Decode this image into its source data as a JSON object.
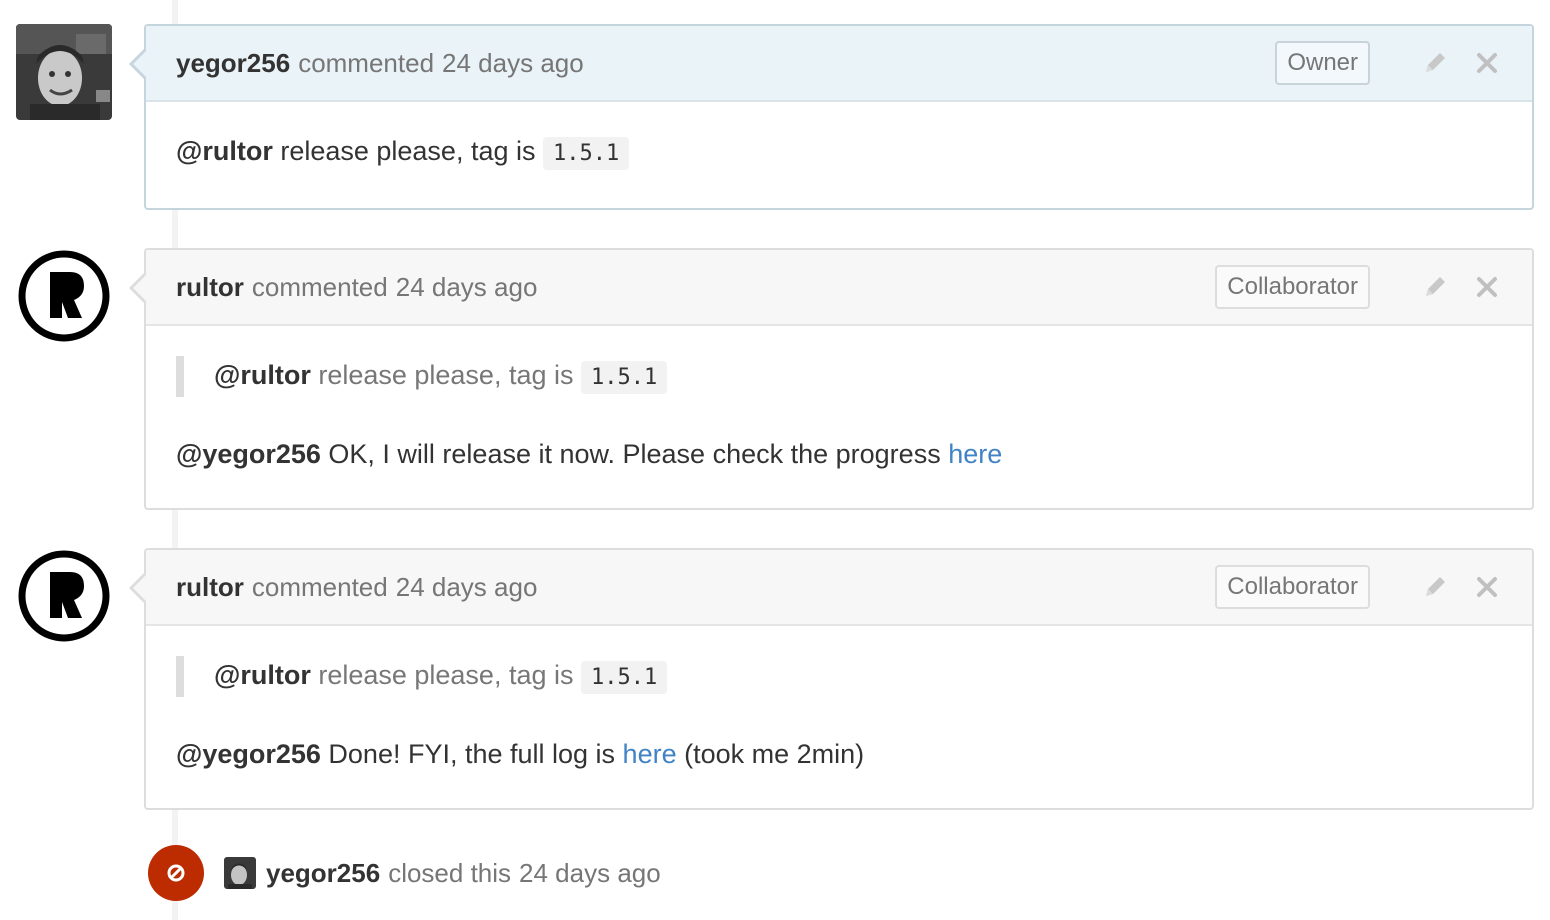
{
  "comments": [
    {
      "author": "yegor256",
      "action": "commented",
      "time": "24 days ago",
      "role": "Owner",
      "body": {
        "mention": "@rultor",
        "text": " release please, tag is ",
        "tag": "1.5.1"
      }
    },
    {
      "author": "rultor",
      "action": "commented",
      "time": "24 days ago",
      "role": "Collaborator",
      "quote": {
        "mention": "@rultor",
        "text": " release please, tag is ",
        "tag": "1.5.1"
      },
      "body": {
        "mention": "@yegor256",
        "text": " OK, I will release it now. Please check the progress ",
        "link": "here"
      }
    },
    {
      "author": "rultor",
      "action": "commented",
      "time": "24 days ago",
      "role": "Collaborator",
      "quote": {
        "mention": "@rultor",
        "text": " release please, tag is ",
        "tag": "1.5.1"
      },
      "body": {
        "mention": "@yegor256",
        "text": " Done! FYI, the full log is ",
        "link": "here",
        "suffix": " (took me 2min)"
      }
    }
  ],
  "closed_event": {
    "actor": "yegor256",
    "text": "closed this",
    "time": "24 days ago"
  },
  "icons": {
    "edit": "pencil-icon",
    "delete": "close-icon",
    "closed": "circle-slash-icon"
  },
  "colors": {
    "link": "#4183c4",
    "closed_badge": "#bd2c00",
    "owner_header": "#eaf3f7"
  }
}
